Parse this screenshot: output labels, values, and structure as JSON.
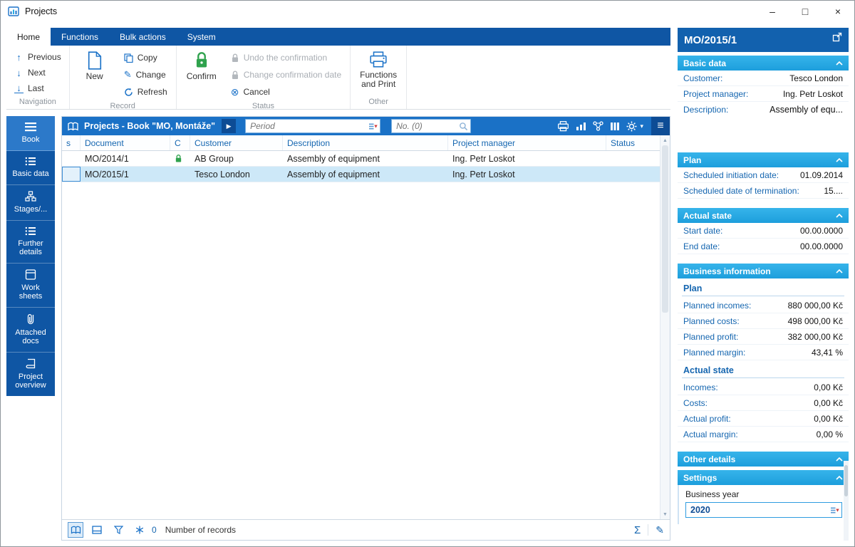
{
  "colors": {
    "accent_blue": "#0f56a4",
    "header_blue": "#1a71c6",
    "cyan_header": "#29ace3",
    "selected_row": "#cde8f8",
    "confirm_green": "#2fa24d"
  },
  "icons": {
    "minimize": "–",
    "maximize": "□",
    "close": "×",
    "previous": "↑",
    "next": "↓",
    "last": "↓",
    "cancel": "⊗",
    "play": "▶",
    "menu": "≡",
    "gear_caret": "▾",
    "sum": "Σ",
    "edit": "✎",
    "scroll_up": "▲",
    "scroll_down": "▼"
  },
  "titlebar": {
    "title": "Projects"
  },
  "tabs": [
    {
      "label": "Home"
    },
    {
      "label": "Functions"
    },
    {
      "label": "Bulk actions"
    },
    {
      "label": "System"
    }
  ],
  "ribbon": {
    "navigation": {
      "label": "Navigation",
      "previous": "Previous",
      "next": "Next",
      "last": "Last"
    },
    "record": {
      "label": "Record",
      "new": "New",
      "copy": "Copy",
      "change": "Change",
      "refresh": "Refresh"
    },
    "status": {
      "label": "Status",
      "confirm": "Confirm",
      "undo": "Undo the confirmation",
      "change_date": "Change confirmation date",
      "cancel": "Cancel"
    },
    "other": {
      "label": "Other",
      "functions_print": "Functions and Print"
    }
  },
  "sidebar": {
    "items": [
      {
        "label": "Book"
      },
      {
        "label": "Basic data"
      },
      {
        "label": "Stages/..."
      },
      {
        "label": "Further details"
      },
      {
        "label": "Work sheets"
      },
      {
        "label": "Attached docs"
      },
      {
        "label": "Project overview"
      }
    ]
  },
  "list": {
    "title": "Projects - Book \"MO, Montáže\"",
    "period_placeholder": "Period",
    "search_placeholder": "No. (0)",
    "columns": [
      "s",
      "Document",
      "C",
      "Customer",
      "Description",
      "Project manager",
      "Status"
    ],
    "rows": [
      {
        "document": "MO/2014/1",
        "customer": "AB Group",
        "description": "Assembly of equipment",
        "manager": "Ing. Petr Loskot",
        "status": ""
      },
      {
        "document": "MO/2015/1",
        "customer": "Tesco London",
        "description": "Assembly of equipment",
        "manager": "Ing. Petr Loskot",
        "status": ""
      }
    ],
    "footer": {
      "count": "0",
      "records_label": "Number of records"
    }
  },
  "panel": {
    "title": "MO/2015/1",
    "basic": {
      "header": "Basic data",
      "fields": [
        {
          "label": "Customer:",
          "value": "Tesco London"
        },
        {
          "label": "Project manager:",
          "value": "Ing. Petr Loskot"
        },
        {
          "label": "Description:",
          "value": "Assembly of equ..."
        }
      ]
    },
    "plan": {
      "header": "Plan",
      "fields": [
        {
          "label": "Scheduled initiation date:",
          "value": "01.09.2014"
        },
        {
          "label": "Scheduled date of termination:",
          "value": "15...."
        }
      ]
    },
    "actual": {
      "header": "Actual state",
      "fields": [
        {
          "label": "Start date:",
          "value": "00.00.0000"
        },
        {
          "label": "End date:",
          "value": "00.00.0000"
        }
      ]
    },
    "business": {
      "header": "Business information",
      "plan_heading": "Plan",
      "plan_fields": [
        {
          "label": "Planned incomes:",
          "value": "880 000,00 Kč"
        },
        {
          "label": "Planned costs:",
          "value": "498 000,00 Kč"
        },
        {
          "label": "Planned profit:",
          "value": "382 000,00 Kč"
        },
        {
          "label": "Planned margin:",
          "value": "43,41 %"
        }
      ],
      "actual_heading": "Actual state",
      "actual_fields": [
        {
          "label": "Incomes:",
          "value": "0,00 Kč"
        },
        {
          "label": "Costs:",
          "value": "0,00 Kč"
        },
        {
          "label": "Actual profit:",
          "value": "0,00 Kč"
        },
        {
          "label": "Actual margin:",
          "value": "0,00 %"
        }
      ]
    },
    "other": {
      "header": "Other details"
    },
    "settings": {
      "header": "Settings",
      "year_label": "Business year",
      "year_value": "2020"
    }
  }
}
